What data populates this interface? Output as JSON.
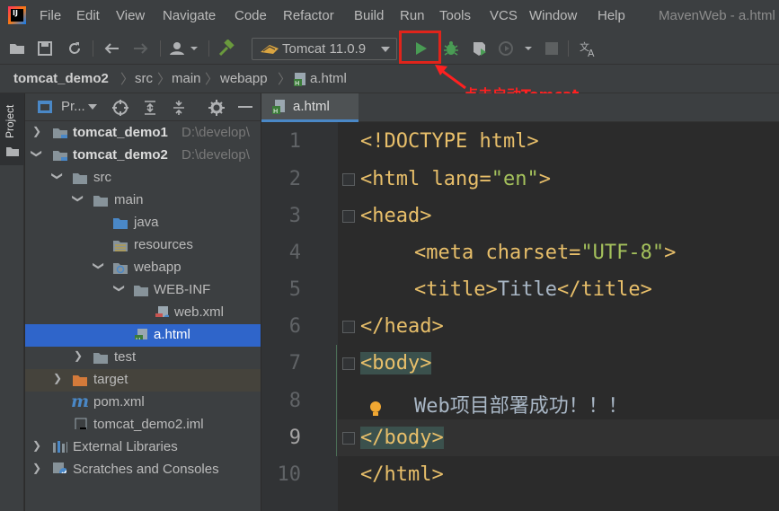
{
  "menu": [
    "File",
    "Edit",
    "View",
    "Navigate",
    "Code",
    "Refactor",
    "Build",
    "Run",
    "Tools",
    "VCS",
    "Window",
    "Help"
  ],
  "window_title": "MavenWeb - a.html",
  "toolbar": {
    "run_config": "Tomcat 11.0.9"
  },
  "annotation": "点击启动Tomcat",
  "breadcrumb": [
    "tomcat_demo2",
    "src",
    "main",
    "webapp",
    "a.html"
  ],
  "side_tab": "Project",
  "panel": {
    "view_label": "Pr..."
  },
  "tree": [
    {
      "label": "tomcat_demo1",
      "path": "D:\\develop\\"
    },
    {
      "label": "tomcat_demo2",
      "path": "D:\\develop\\"
    },
    {
      "label": "src"
    },
    {
      "label": "main"
    },
    {
      "label": "java"
    },
    {
      "label": "resources"
    },
    {
      "label": "webapp"
    },
    {
      "label": "WEB-INF"
    },
    {
      "label": "web.xml"
    },
    {
      "label": "a.html"
    },
    {
      "label": "test"
    },
    {
      "label": "target"
    },
    {
      "label": "pom.xml"
    },
    {
      "label": "tomcat_demo2.iml"
    },
    {
      "label": "External Libraries"
    },
    {
      "label": "Scratches and Consoles"
    }
  ],
  "editor": {
    "tab": "a.html",
    "line_numbers": [
      "1",
      "2",
      "3",
      "4",
      "5",
      "6",
      "7",
      "8",
      "9",
      "10"
    ],
    "lines": {
      "l1": "<!DOCTYPE html>",
      "l2a": "<html lang=",
      "l2b": "\"en\"",
      "l2c": ">",
      "l3": "<head>",
      "l4a": "<meta charset=",
      "l4b": "\"UTF-8\"",
      "l4c": ">",
      "l5a": "<title>",
      "l5b": "Title",
      "l5c": "</title>",
      "l6": "</head>",
      "l7": "<body>",
      "l8": "Web项目部署成功！！！",
      "l9": "</body>",
      "l10": "</html>"
    }
  },
  "colors": {
    "accent": "#2f65ca",
    "run_green": "#499c54",
    "annotation_red": "#ff2020"
  }
}
